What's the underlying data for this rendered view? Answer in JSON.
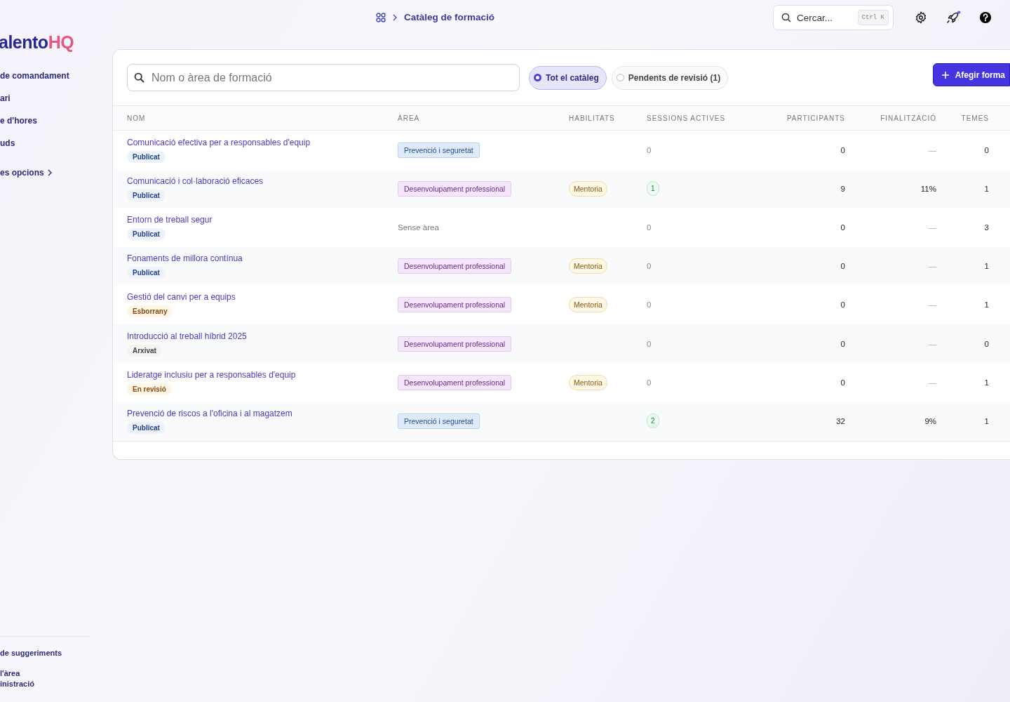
{
  "logo": {
    "main": "alento",
    "accent": "HQ"
  },
  "sidebar": {
    "items": [
      {
        "label": "de comandament",
        "kind": "link"
      },
      {
        "label": "ari",
        "kind": "link"
      },
      {
        "label": "e d'hores",
        "kind": "link"
      },
      {
        "label": "uds",
        "kind": "link"
      },
      {
        "label": "es opcions",
        "kind": "more"
      }
    ],
    "footer": [
      {
        "lines": [
          "de suggeriments"
        ]
      },
      {
        "lines": [
          "l'àrea",
          "inistració"
        ]
      }
    ]
  },
  "breadcrumb": {
    "current": "Catàleg de formació"
  },
  "topbar": {
    "search_placeholder": "Cercar...",
    "shortcut": "Ctrl K",
    "notification": true
  },
  "toolbar": {
    "search_placeholder": "Nom o àrea de formació",
    "filters": [
      {
        "label": "Tot el catàleg",
        "selected": true
      },
      {
        "label": "Pendents de revisió (1)",
        "selected": false
      }
    ],
    "add_button": "Afegir forma"
  },
  "table": {
    "columns": [
      "NOM",
      "ÀREA",
      "HABILITATS",
      "SESSIONS ACTIVES",
      "PARTICIPANTS",
      "FINALITZACIÓ",
      "TEMES"
    ],
    "rows": [
      {
        "name": "Comunicació efectiva per a responsables d'equip",
        "status": {
          "label": "Publicat",
          "kind": "published"
        },
        "area": {
          "label": "Prevenció i seguretat",
          "kind": "safety"
        },
        "skill": null,
        "sessions": {
          "label": "0",
          "kind": "plain"
        },
        "participants": "0",
        "completion": {
          "label": "—",
          "kind": "empty"
        },
        "topics": "0"
      },
      {
        "name": "Comunicació i col·laboració eficaces",
        "status": {
          "label": "Publicat",
          "kind": "published"
        },
        "area": {
          "label": "Desenvolupament professional",
          "kind": "development"
        },
        "skill": "Mentoria",
        "sessions": {
          "label": "1",
          "kind": "badge"
        },
        "participants": "9",
        "completion": {
          "label": "11%",
          "kind": "value"
        },
        "topics": "1"
      },
      {
        "name": "Entorn de treball segur",
        "status": {
          "label": "Publicat",
          "kind": "published"
        },
        "area": {
          "label": "Sense àrea",
          "kind": "none"
        },
        "skill": null,
        "sessions": {
          "label": "0",
          "kind": "plain"
        },
        "participants": "0",
        "completion": {
          "label": "—",
          "kind": "empty"
        },
        "topics": "3"
      },
      {
        "name": "Fonaments de millora contínua",
        "status": {
          "label": "Publicat",
          "kind": "published"
        },
        "area": {
          "label": "Desenvolupament professional",
          "kind": "development"
        },
        "skill": "Mentoria",
        "sessions": {
          "label": "0",
          "kind": "plain"
        },
        "participants": "0",
        "completion": {
          "label": "—",
          "kind": "empty"
        },
        "topics": "1"
      },
      {
        "name": "Gestió del canvi per a equips",
        "status": {
          "label": "Esborrany",
          "kind": "draft"
        },
        "area": {
          "label": "Desenvolupament professional",
          "kind": "development"
        },
        "skill": "Mentoria",
        "sessions": {
          "label": "0",
          "kind": "plain"
        },
        "participants": "0",
        "completion": {
          "label": "—",
          "kind": "empty"
        },
        "topics": "1"
      },
      {
        "name": "Introducció al treball híbrid 2025",
        "status": {
          "label": "Arxivat",
          "kind": "archived"
        },
        "area": {
          "label": "Desenvolupament professional",
          "kind": "development"
        },
        "skill": null,
        "sessions": {
          "label": "0",
          "kind": "plain"
        },
        "participants": "0",
        "completion": {
          "label": "—",
          "kind": "empty"
        },
        "topics": "0"
      },
      {
        "name": "Lideratge inclusiu per a responsables d'equip",
        "status": {
          "label": "En revisió",
          "kind": "review"
        },
        "area": {
          "label": "Desenvolupament professional",
          "kind": "development"
        },
        "skill": "Mentoria",
        "sessions": {
          "label": "0",
          "kind": "plain"
        },
        "participants": "0",
        "completion": {
          "label": "—",
          "kind": "empty"
        },
        "topics": "1"
      },
      {
        "name": "Prevenció de riscos a l'oficina i al magatzem",
        "status": {
          "label": "Publicat",
          "kind": "published"
        },
        "area": {
          "label": "Prevenció i seguretat",
          "kind": "safety"
        },
        "skill": null,
        "sessions": {
          "label": "2",
          "kind": "badge"
        },
        "participants": "32",
        "completion": {
          "label": "9%",
          "kind": "value"
        },
        "topics": "1"
      }
    ]
  }
}
